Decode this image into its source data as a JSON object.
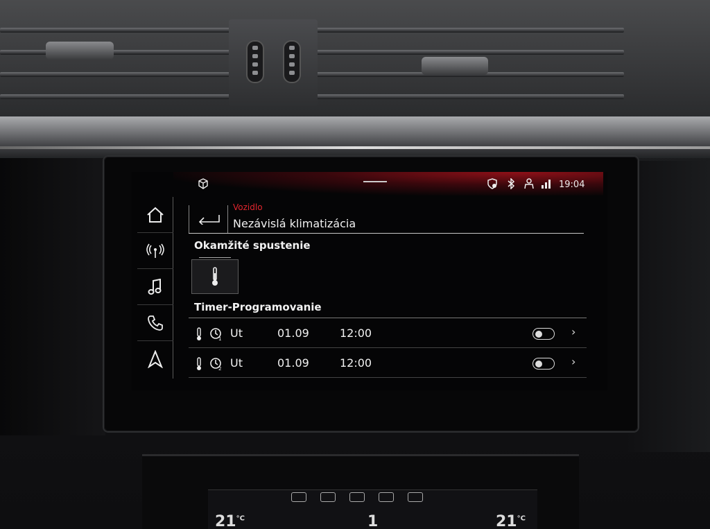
{
  "statusbar": {
    "time": "19:04",
    "icons": [
      "car-cube-icon",
      "lock-shield-icon",
      "bluetooth-icon",
      "person-icon",
      "signal-lte-icon"
    ]
  },
  "nav": {
    "items": [
      {
        "name": "home",
        "icon": "home-icon"
      },
      {
        "name": "connectivity",
        "icon": "antenna-icon"
      },
      {
        "name": "media",
        "icon": "music-note-icon"
      },
      {
        "name": "phone",
        "icon": "phone-icon"
      },
      {
        "name": "navigation",
        "icon": "navigation-arrow-icon"
      }
    ]
  },
  "header": {
    "breadcrumb": "Vozidlo",
    "title": "Nezávislá klimatizácia"
  },
  "instant": {
    "label": "Okamžité spustenie",
    "button_icon": "thermometer-icon"
  },
  "timers": {
    "label": "Timer-Programovanie",
    "rows": [
      {
        "day": "Ut",
        "date": "01.09",
        "time": "12:00",
        "enabled": false
      },
      {
        "day": "Ut",
        "date": "01.09",
        "time": "12:00",
        "enabled": false
      }
    ]
  },
  "climate": {
    "left_temp": "21",
    "right_temp": "21",
    "unit": "°C",
    "fan_level": "1"
  },
  "colors": {
    "accent": "#e3262e",
    "text": "#f0f0f0",
    "background": "#050506"
  }
}
